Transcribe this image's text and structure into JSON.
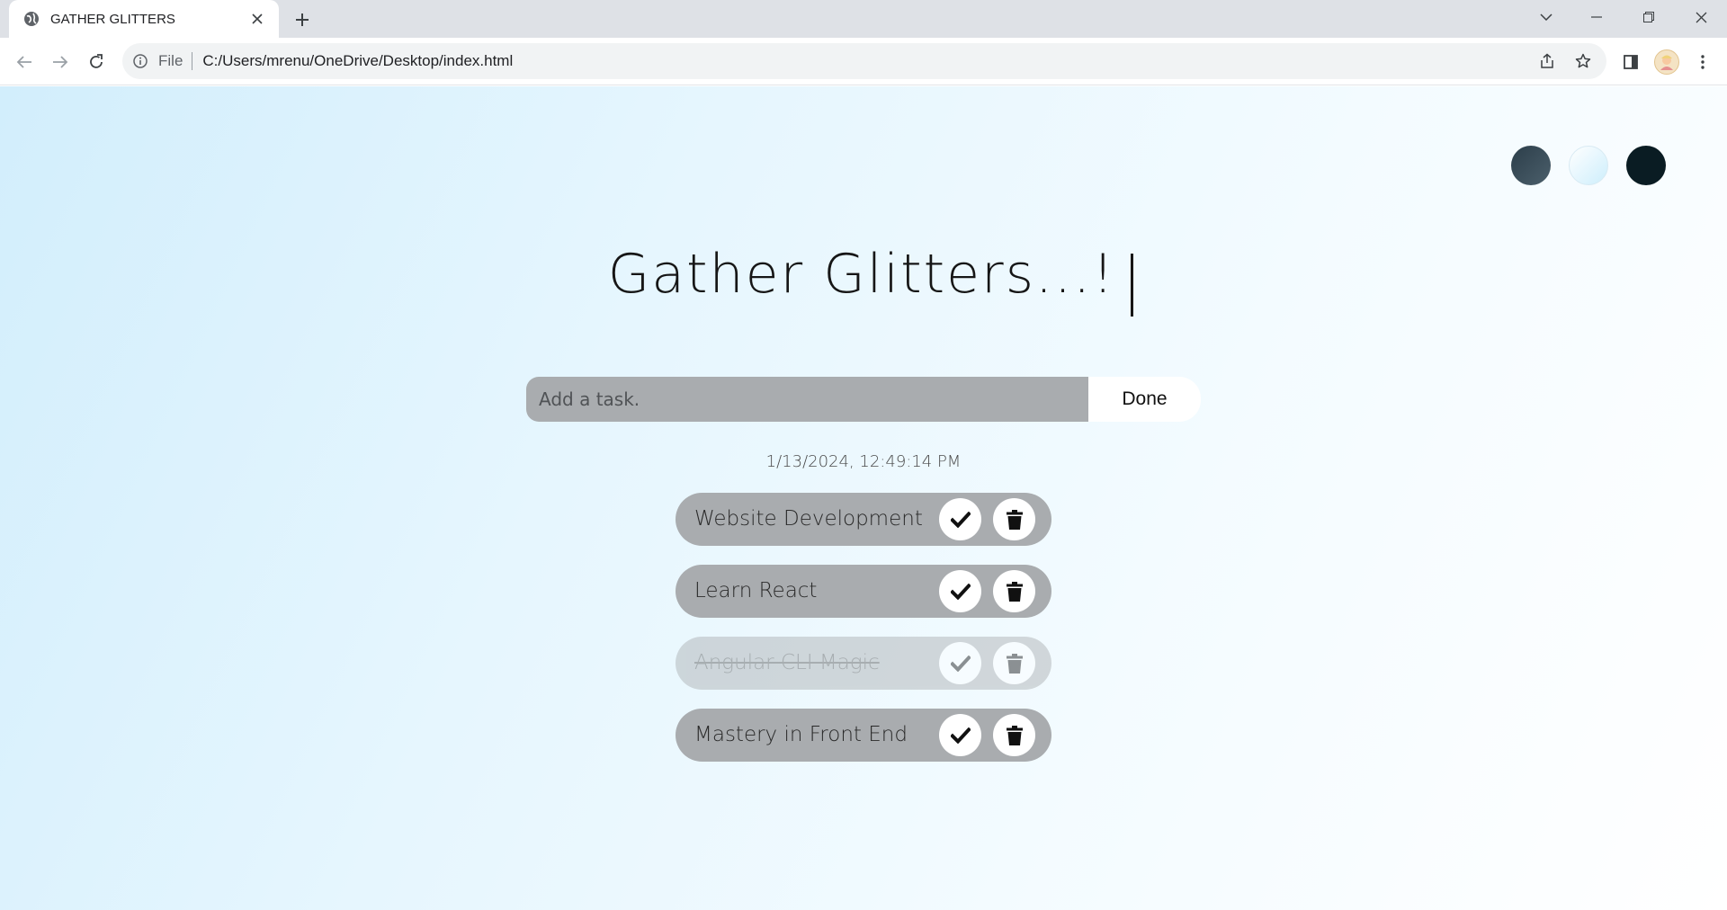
{
  "browser": {
    "tab_title": "GATHER GLITTERS",
    "address_scheme": "File",
    "address_url": "C:/Users/mrenu/OneDrive/Desktop/index.html"
  },
  "icons": {
    "favicon": "globe-icon",
    "close": "close-icon",
    "new_tab": "plus-icon",
    "back": "arrow-left-icon",
    "forward": "arrow-right-icon",
    "reload": "reload-icon",
    "info": "info-icon",
    "share": "share-icon",
    "bookmark": "star-icon",
    "side_panel": "side-panel-icon",
    "menu": "kebab-menu-icon",
    "task_complete": "check-icon",
    "task_delete": "trash-icon"
  },
  "theme_colors": [
    "#2c3e4a",
    "#cdeefc",
    "#0a1c23"
  ],
  "app": {
    "heading": "Gather Glitters...!",
    "input_placeholder": "Add a task.",
    "done_label": "Done",
    "datetime": "1/13/2024, 12:49:14 PM"
  },
  "tasks": [
    {
      "text": "Website Development",
      "completed": false
    },
    {
      "text": "Learn React",
      "completed": false
    },
    {
      "text": "Angular CLI Magic",
      "completed": true
    },
    {
      "text": "Mastery in Front End",
      "completed": false
    }
  ]
}
